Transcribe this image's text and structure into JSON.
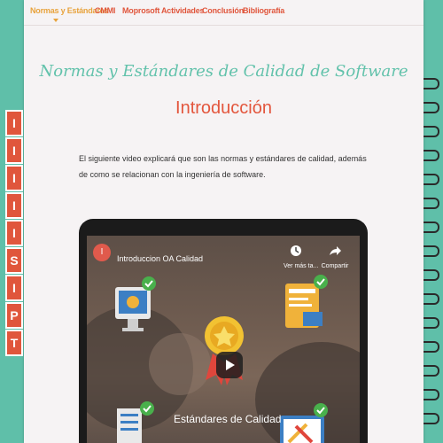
{
  "nav": {
    "items": [
      {
        "label": "Normas y Estándares"
      },
      {
        "label": "CMMI"
      },
      {
        "label": "Moprosoft"
      },
      {
        "label": "Actividades"
      },
      {
        "label": "Conclusión"
      },
      {
        "label": "Bibliografía"
      }
    ],
    "accent": "#e8a33c",
    "link_color": "#e0563c"
  },
  "page": {
    "title": "Normas y Estándares de Calidad de Software",
    "subtitle": "Introducción",
    "intro": "El siguiente video explicará que son las normas y estándares de calidad, además de como se relacionan con la ingeniería de software."
  },
  "video": {
    "channel_initial": "I",
    "title": "Introduccion OA Calidad",
    "watch_later_label": "Ver más ta...",
    "share_label": "Compartir",
    "overlay_text": "Estándares de Calidad"
  },
  "side_tabs": [
    "I",
    "I",
    "I",
    "I",
    "I",
    "S",
    "I",
    "P",
    "T"
  ],
  "colors": {
    "background": "#5fbfa9",
    "paper": "#f6f3f4",
    "title": "#62c2ab",
    "subtitle": "#e3563d"
  }
}
